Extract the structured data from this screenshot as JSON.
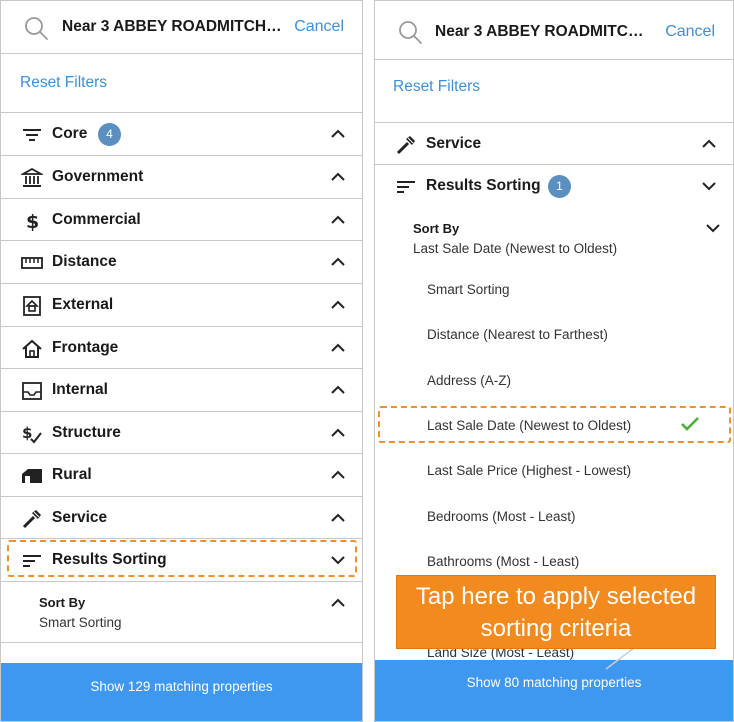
{
  "left": {
    "search_text": "Near 3 ABBEY ROADMITCHE...",
    "cancel": "Cancel",
    "reset": "Reset Filters",
    "rows": [
      {
        "label": "Core",
        "badge": "4",
        "icon": "filter-lines-icon"
      },
      {
        "label": "Government",
        "icon": "bank-icon"
      },
      {
        "label": "Commercial",
        "icon": "dollar-icon"
      },
      {
        "label": "Distance",
        "icon": "ruler-icon"
      },
      {
        "label": "External",
        "icon": "external-house-icon"
      },
      {
        "label": "Frontage",
        "icon": "home-icon"
      },
      {
        "label": "Internal",
        "icon": "inbox-icon"
      },
      {
        "label": "Structure",
        "icon": "dollar-check-icon"
      },
      {
        "label": "Rural",
        "icon": "barn-icon"
      },
      {
        "label": "Service",
        "icon": "wrench-icon"
      },
      {
        "label": "Results Sorting",
        "icon": "sort-lines-icon"
      }
    ],
    "sort_by_label": "Sort By",
    "sort_by_value": "Smart Sorting",
    "footer": "Show 129 matching properties"
  },
  "right": {
    "search_text": "Near 3 ABBEY ROADMITCHE...",
    "cancel": "Cancel",
    "reset": "Reset Filters",
    "service_label": "Service",
    "results_label": "Results Sorting",
    "results_badge": "1",
    "sort_by_label": "Sort By",
    "sort_by_value": "Last Sale Date (Newest to Oldest)",
    "options": [
      "Smart Sorting",
      "Distance (Nearest to Farthest)",
      "Address (A-Z)",
      "Last Sale Date (Newest to Oldest)",
      "Last Sale Price (Highest - Lowest)",
      "Bedrooms (Most - Least)",
      "Bathrooms (Most - Least)",
      "Land Size (Most - Least)"
    ],
    "selected_option": "Last Sale Date (Newest to Oldest)",
    "footer": "Show 80 matching properties"
  },
  "callout_line1": "Tap here to apply selected",
  "callout_line2": "sorting criteria",
  "colors": {
    "accent": "#3d8fd6",
    "footer": "#3e98f0",
    "badge": "#5a8fbf",
    "highlight": "#f0902a",
    "check": "#4caf3a"
  }
}
